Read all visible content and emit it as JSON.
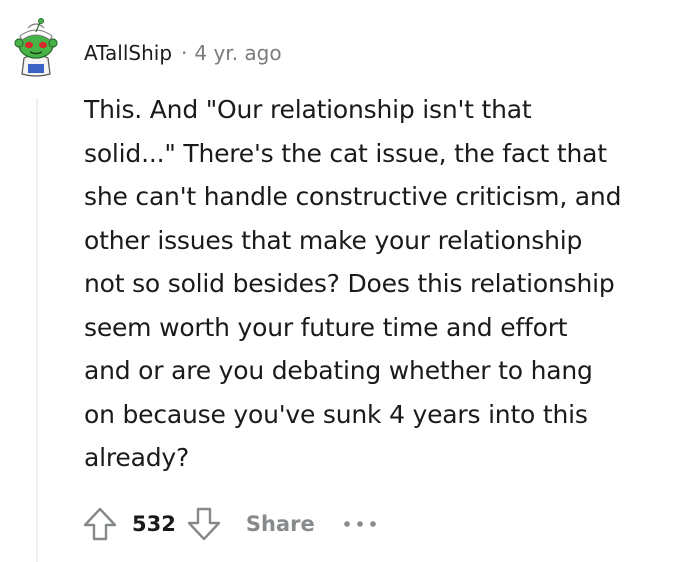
{
  "comment": {
    "username": "ATallShip",
    "separator": "·",
    "timestamp": "4 yr. ago",
    "body": "This. And \"Our relationship isn't that\nsolid...\" There's the cat issue, the fact that\nshe can't handle constructive criticism, and\nother issues that make your relationship\nnot so solid besides? Does this relationship\nseem worth your future time and effort\nand or are you debating whether to hang\non because you've sunk 4 years into this\nalready?"
  },
  "actions": {
    "upvote_icon": "upvote-arrow-icon",
    "vote_count": "532",
    "downvote_icon": "downvote-arrow-icon",
    "share_label": "Share",
    "more_icon": "ellipsis-icon"
  },
  "colors": {
    "text": "#1a1a1b",
    "meta": "#7c7c7c",
    "icon": "#878a8c",
    "thread_line": "#edeff1",
    "avatar_green": "#46b447"
  }
}
